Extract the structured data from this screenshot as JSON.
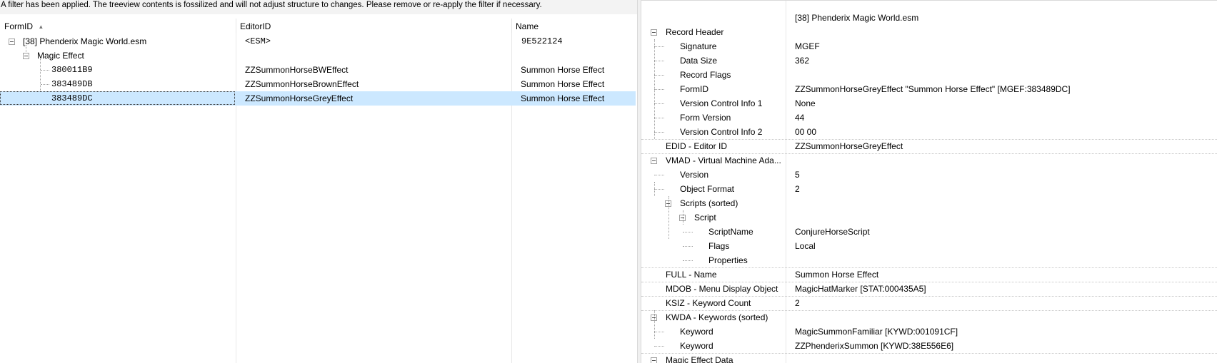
{
  "banner": "A filter has been applied. The treeview contents is fossilized and will not adjust structure to changes.  Please remove or re-apply the filter if necessary.",
  "columns": {
    "formid": "FormID",
    "sort_arrow": "▲",
    "editorid": "EditorID",
    "name": "Name"
  },
  "tree": {
    "file": {
      "label": "[38] Phenderix Magic World.esm",
      "editorid": "<ESM>",
      "name": "9E522124"
    },
    "group": {
      "label": "Magic Effect"
    },
    "records": [
      {
        "formid": "380011B9",
        "editorid": "ZZSummonHorseBWEffect",
        "name": "Summon Horse Effect"
      },
      {
        "formid": "383489DB",
        "editorid": "ZZSummonHorseBrownEffect",
        "name": "Summon Horse Effect"
      },
      {
        "formid": "383489DC",
        "editorid": "ZZSummonHorseGreyEffect",
        "name": "Summon Horse Effect"
      }
    ]
  },
  "details": {
    "file_header": "[38] Phenderix Magic World.esm",
    "rows": [
      {
        "label": "Record Header",
        "value": ""
      },
      {
        "label": "Signature",
        "value": "MGEF"
      },
      {
        "label": "Data Size",
        "value": "362"
      },
      {
        "label": "Record Flags",
        "value": ""
      },
      {
        "label": "FormID",
        "value": "ZZSummonHorseGreyEffect \"Summon Horse Effect\" [MGEF:383489DC]"
      },
      {
        "label": "Version Control Info 1",
        "value": "None"
      },
      {
        "label": "Form Version",
        "value": "44"
      },
      {
        "label": "Version Control Info 2",
        "value": "00 00"
      },
      {
        "label": "EDID - Editor ID",
        "value": "ZZSummonHorseGreyEffect"
      },
      {
        "label": "VMAD - Virtual Machine Ada...",
        "value": ""
      },
      {
        "label": "Version",
        "value": "5"
      },
      {
        "label": "Object Format",
        "value": "2"
      },
      {
        "label": "Scripts (sorted)",
        "value": ""
      },
      {
        "label": "Script",
        "value": ""
      },
      {
        "label": "ScriptName",
        "value": "ConjureHorseScript"
      },
      {
        "label": "Flags",
        "value": "Local"
      },
      {
        "label": "Properties",
        "value": ""
      },
      {
        "label": "FULL - Name",
        "value": "Summon Horse Effect"
      },
      {
        "label": "MDOB - Menu Display Object",
        "value": "MagicHatMarker [STAT:000435A5]"
      },
      {
        "label": "KSIZ - Keyword Count",
        "value": "2"
      },
      {
        "label": "KWDA - Keywords (sorted)",
        "value": ""
      },
      {
        "label": "Keyword",
        "value": "MagicSummonFamiliar [KYWD:001091CF]"
      },
      {
        "label": "Keyword",
        "value": "ZZPhenderixSummon [KYWD:38E556E6]"
      },
      {
        "label": "Magic Effect Data",
        "value": ""
      }
    ]
  }
}
